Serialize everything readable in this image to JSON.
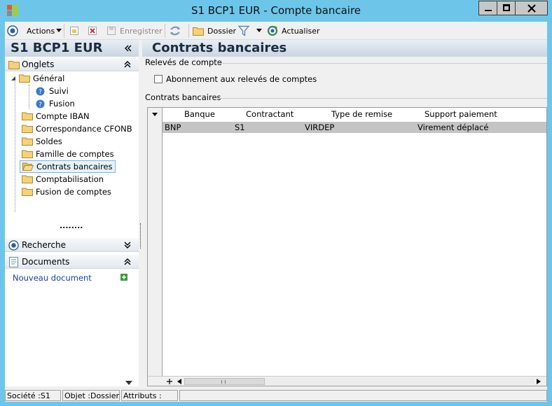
{
  "window": {
    "title": "S1 BCP1 EUR -  Compte bancaire"
  },
  "toolbar": {
    "actions_label": "Actions",
    "save_label": "Enregistrer",
    "dossier_label": "Dossier",
    "refresh_label": "Actualiser"
  },
  "left": {
    "header_title": "S1 BCP1 EUR",
    "onglets_label": "Onglets",
    "tree": {
      "general": "Général",
      "suivi": "Suivi",
      "fusion": "Fusion",
      "iban": "Compte IBAN",
      "cfonb": "Correspondance CFONB",
      "soldes": "Soldes",
      "famille": "Famille de comptes",
      "contrats": "Contrats bancaires",
      "compta": "Comptabilisation",
      "fusion_comptes": "Fusion de comptes"
    },
    "dots": "........",
    "recherche_label": "Recherche",
    "documents_label": "Documents",
    "new_document_link": "Nouveau document"
  },
  "main": {
    "title": "Contrats bancaires",
    "releves_group": "Relevés de compte",
    "abonnement_label": "Abonnement aux relevés de comptes",
    "contrats_group": "Contrats bancaires",
    "columns": [
      "Banque",
      "Contractant",
      "Type de remise",
      "Support paiement"
    ],
    "rows": [
      {
        "banque": "BNP",
        "contractant": "S1",
        "type": "VIRDEP",
        "support": "Virement déplacé"
      }
    ]
  },
  "statusbar": {
    "societe": "Société :S1",
    "objet": "Objet :Dossier",
    "attributs": "Attributs :"
  }
}
